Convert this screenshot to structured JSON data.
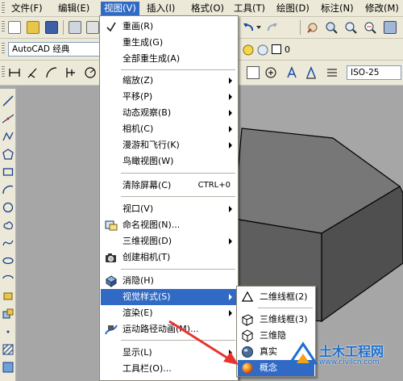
{
  "menubar": {
    "items": [
      {
        "label": "文件(F)",
        "active": false
      },
      {
        "label": "编辑(E)",
        "active": false
      },
      {
        "label": "视图(V)",
        "active": true
      },
      {
        "label": "插入(I)",
        "active": false
      },
      {
        "label": "格式(O)",
        "active": false
      },
      {
        "label": "工具(T)",
        "active": false
      },
      {
        "label": "绘图(D)",
        "active": false
      },
      {
        "label": "标注(N)",
        "active": false
      },
      {
        "label": "修改(M)",
        "active": false
      }
    ]
  },
  "toolbar": {
    "workspace_value": "AutoCAD 经典",
    "layer_value": "0",
    "dimstyle_value": "ISO-25"
  },
  "view_menu": {
    "items": [
      {
        "label": "重画(R)",
        "shortcut": "",
        "submenu": false,
        "icon": "redraw-icon"
      },
      {
        "label": "重生成(G)",
        "shortcut": "",
        "submenu": false,
        "icon": ""
      },
      {
        "label": "全部重生成(A)",
        "shortcut": "",
        "submenu": false,
        "icon": ""
      },
      {
        "label": "缩放(Z)",
        "shortcut": "",
        "submenu": true,
        "icon": ""
      },
      {
        "label": "平移(P)",
        "shortcut": "",
        "submenu": true,
        "icon": ""
      },
      {
        "label": "动态观察(B)",
        "shortcut": "",
        "submenu": true,
        "icon": ""
      },
      {
        "label": "相机(C)",
        "shortcut": "",
        "submenu": true,
        "icon": ""
      },
      {
        "label": "漫游和飞行(K)",
        "shortcut": "",
        "submenu": true,
        "icon": ""
      },
      {
        "label": "鸟瞰视图(W)",
        "shortcut": "",
        "submenu": false,
        "icon": ""
      },
      {
        "label": "清除屏幕(C)",
        "shortcut": "CTRL+0",
        "submenu": false,
        "icon": ""
      },
      {
        "label": "视口(V)",
        "shortcut": "",
        "submenu": true,
        "icon": ""
      },
      {
        "label": "命名视图(N)...",
        "shortcut": "",
        "submenu": false,
        "icon": "named-view-icon"
      },
      {
        "label": "三维视图(D)",
        "shortcut": "",
        "submenu": true,
        "icon": ""
      },
      {
        "label": "创建相机(T)",
        "shortcut": "",
        "submenu": false,
        "icon": "camera-icon"
      },
      {
        "label": "消隐(H)",
        "shortcut": "",
        "submenu": false,
        "icon": "hide-icon"
      },
      {
        "label": "视觉样式(S)",
        "shortcut": "",
        "submenu": true,
        "icon": ""
      },
      {
        "label": "渲染(E)",
        "shortcut": "",
        "submenu": true,
        "icon": ""
      },
      {
        "label": "运动路径动画(M)...",
        "shortcut": "",
        "submenu": false,
        "icon": "motion-path-icon"
      },
      {
        "label": "显示(L)",
        "shortcut": "",
        "submenu": true,
        "icon": ""
      },
      {
        "label": "工具栏(O)...",
        "shortcut": "",
        "submenu": false,
        "icon": ""
      }
    ],
    "highlighted": "视觉样式(S)"
  },
  "visual_style_menu": {
    "items": [
      {
        "label": "二维线框(2)",
        "icon": "2d-wireframe-icon"
      },
      {
        "label": "三维线框(3)",
        "icon": "3d-wireframe-icon"
      },
      {
        "label": "三维隐",
        "icon": "3d-hidden-icon"
      },
      {
        "label": "真实",
        "icon": "realistic-icon"
      },
      {
        "label": "概念",
        "icon": "conceptual-icon"
      }
    ],
    "highlighted": "概念"
  },
  "watermark": {
    "title": "土木工程网",
    "url": "www.civilcn.com"
  },
  "colors": {
    "menu_highlight": "#316ac5",
    "annotation_arrow": "#e8342e",
    "watermark_blue": "#1e6fd0"
  }
}
